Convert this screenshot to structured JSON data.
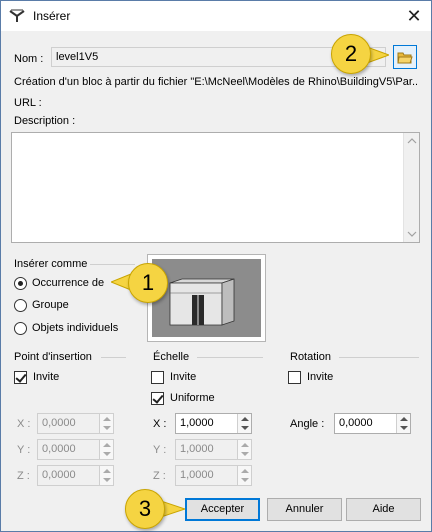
{
  "window": {
    "title": "Insérer",
    "close_glyph": "✕"
  },
  "name_row": {
    "label": "Nom :",
    "value": "level1V5"
  },
  "info_text": "Création d'un bloc à partir du fichier \"E:\\McNeel\\Modèles de Rhino\\BuildingV5\\Par...",
  "url_label": "URL :",
  "description_label": "Description :",
  "insert_as": {
    "label": "Insérer comme",
    "options": [
      {
        "label": "Occurrence de",
        "checked": true
      },
      {
        "label": "Groupe",
        "checked": false
      },
      {
        "label": "Objets individuels",
        "checked": false
      }
    ]
  },
  "insertion_point": {
    "label": "Point d'insertion",
    "prompt_label": "Invite",
    "prompt_checked": true,
    "x_label": "X :",
    "x_value": "0,0000",
    "y_label": "Y :",
    "y_value": "0,0000",
    "z_label": "Z :",
    "z_value": "0,0000"
  },
  "scale": {
    "label": "Échelle",
    "prompt_label": "Invite",
    "prompt_checked": false,
    "uniform_label": "Uniforme",
    "uniform_checked": true,
    "x_label": "X :",
    "x_value": "1,0000",
    "y_label": "Y :",
    "y_value": "1,0000",
    "z_label": "Z :",
    "z_value": "1,0000"
  },
  "rotation": {
    "label": "Rotation",
    "prompt_label": "Invite",
    "prompt_checked": false,
    "angle_label": "Angle :",
    "angle_value": "0,0000"
  },
  "buttons": {
    "accept": "Accepter",
    "cancel": "Annuler",
    "help": "Aide"
  },
  "callouts": {
    "one": "1",
    "two": "2",
    "three": "3"
  },
  "colors": {
    "callout": "#f5d442",
    "accent": "#0078d7"
  }
}
